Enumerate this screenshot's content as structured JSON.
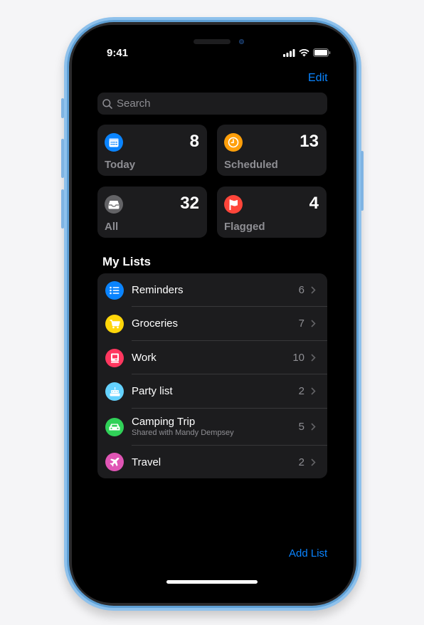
{
  "status_bar": {
    "time": "9:41"
  },
  "nav": {
    "edit_label": "Edit"
  },
  "search": {
    "placeholder": "Search"
  },
  "smart_lists": [
    {
      "label": "Today",
      "count": "8",
      "icon": "calendar-icon",
      "color": "#0a84ff"
    },
    {
      "label": "Scheduled",
      "count": "13",
      "icon": "clock-icon",
      "color": "#ff9f0a"
    },
    {
      "label": "All",
      "count": "32",
      "icon": "tray-icon",
      "color": "#636366"
    },
    {
      "label": "Flagged",
      "count": "4",
      "icon": "flag-icon",
      "color": "#ff453a"
    }
  ],
  "my_lists": {
    "title": "My Lists",
    "items": [
      {
        "name": "Reminders",
        "count": "6",
        "icon": "list-bullet-icon",
        "color": "#0a84ff"
      },
      {
        "name": "Groceries",
        "count": "7",
        "icon": "cart-icon",
        "color": "#ffd60a"
      },
      {
        "name": "Work",
        "count": "10",
        "icon": "desktop-icon",
        "color": "#ff375f"
      },
      {
        "name": "Party list",
        "count": "2",
        "icon": "cake-icon",
        "color": "#64d2ff"
      },
      {
        "name": "Camping Trip",
        "subtitle": "Shared with Mandy Dempsey",
        "count": "5",
        "icon": "car-icon",
        "color": "#30d158"
      },
      {
        "name": "Travel",
        "count": "2",
        "icon": "airplane-icon",
        "color": "#e055b5"
      }
    ]
  },
  "footer": {
    "add_list_label": "Add List"
  }
}
